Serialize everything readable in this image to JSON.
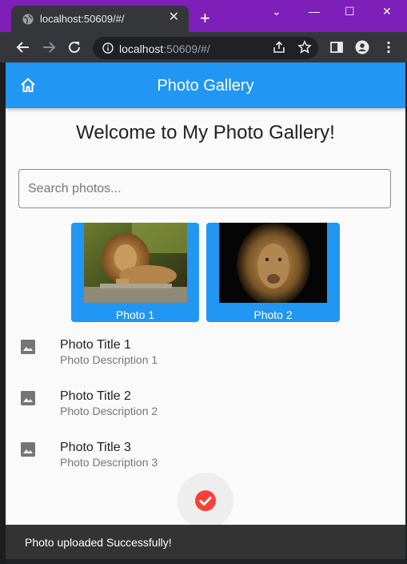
{
  "browser": {
    "tab_title": "localhost:50609/#/",
    "url_host": "localhost",
    "url_rest": ":50609/#/",
    "new_tab_label": "+",
    "tab_close_label": "✕",
    "minimize_label": "—",
    "maximize_label": "☐",
    "close_label": "✕",
    "restore_label": "⌄"
  },
  "app": {
    "title": "Photo Gallery",
    "welcome": "Welcome to My Photo Gallery!",
    "search_placeholder": "Search photos...",
    "accent": "#2196f3",
    "photos": [
      {
        "caption": "Photo 1"
      },
      {
        "caption": "Photo 2"
      }
    ],
    "list": [
      {
        "title": "Photo Title 1",
        "description": "Photo Description 1"
      },
      {
        "title": "Photo Title 2",
        "description": "Photo Description 2"
      },
      {
        "title": "Photo Title 3",
        "description": "Photo Description 3"
      }
    ],
    "snackbar": "Photo uploaded Successfully!"
  }
}
